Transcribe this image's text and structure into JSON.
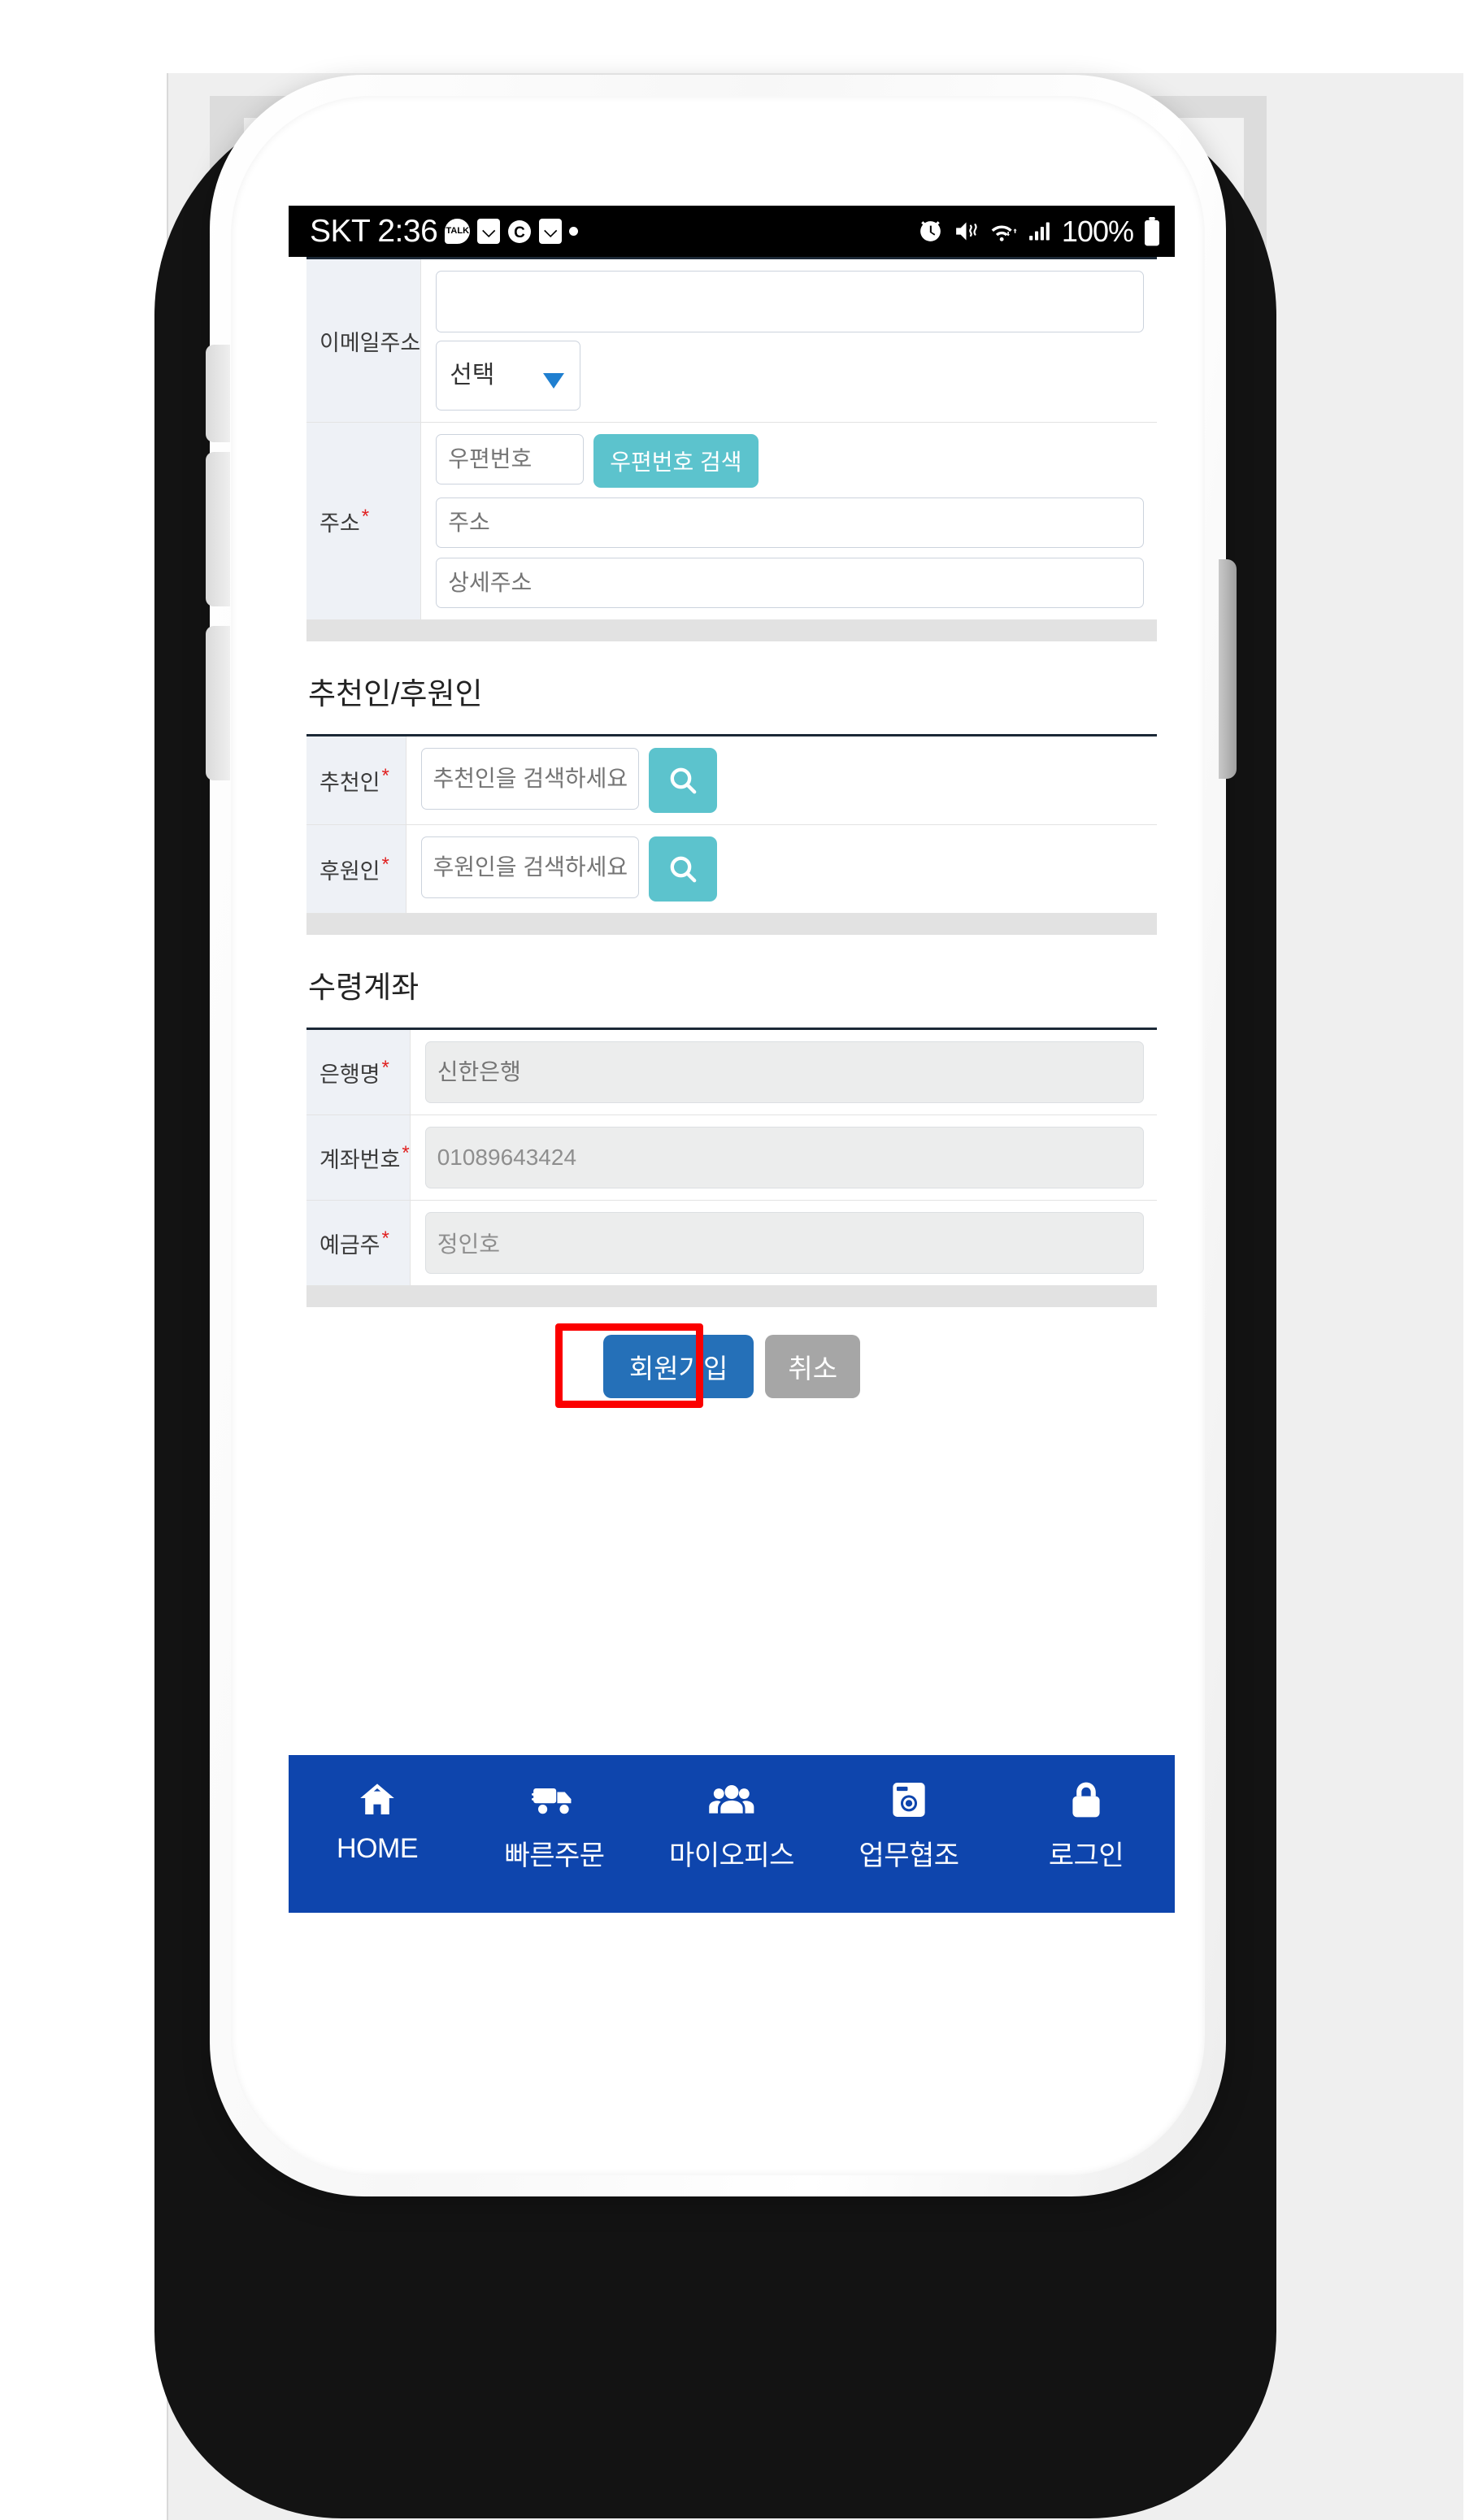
{
  "status_bar": {
    "carrier": "SKT",
    "time": "2:36",
    "talk_icon_label": "TALK",
    "icons": [
      "kakaotalk-icon",
      "smile-icon",
      "c-icon",
      "smile-icon",
      "dot-icon"
    ],
    "right_icons": [
      "alarm-icon",
      "mute-icon",
      "wifi-icon",
      "signal-icon"
    ],
    "battery_percent": "100%"
  },
  "form": {
    "email_row": {
      "label": "이메일주소",
      "input_value": "",
      "input_placeholder": "",
      "select_value": "선택"
    },
    "address_row": {
      "label": "주소",
      "required": "*",
      "zip_placeholder": "우편번호",
      "zip_value": "",
      "zip_button": "우편번호 검색",
      "address_placeholder": "주소",
      "address_value": "",
      "detail_placeholder": "상세주소",
      "detail_value": ""
    }
  },
  "referrer_section": {
    "heading": "추천인/후원인",
    "rows": [
      {
        "label": "추천인",
        "required": "*",
        "placeholder": "추천인을 검색하세요",
        "value": "",
        "button_icon": "search-icon"
      },
      {
        "label": "후원인",
        "required": "*",
        "placeholder": "후원인을 검색하세요",
        "value": "",
        "button_icon": "search-icon"
      }
    ]
  },
  "account_section": {
    "heading": "수령계좌",
    "rows": [
      {
        "label": "은행명",
        "required": "*",
        "value": "신한은행",
        "placeholder": "신한은행",
        "state": "placeholder"
      },
      {
        "label": "계좌번호",
        "required": "*",
        "value": "01089643424",
        "placeholder": "",
        "state": "filled"
      },
      {
        "label": "예금주",
        "required": "*",
        "value": "정인호",
        "placeholder": "",
        "state": "filled"
      }
    ]
  },
  "actions": {
    "submit_label": "회원가입",
    "cancel_label": "취소",
    "highlight_color": "#fb0000",
    "submit_color": "#2570b8",
    "cancel_color": "#a6a6a6"
  },
  "bottom_nav": {
    "background": "#0e45ad",
    "items": [
      {
        "icon": "home-icon",
        "label": "HOME"
      },
      {
        "icon": "truck-icon",
        "label": "빠른주문"
      },
      {
        "icon": "users-icon",
        "label": "마이오피스"
      },
      {
        "icon": "camera-icon",
        "label": "업무협조"
      },
      {
        "icon": "lock-icon",
        "label": "로그인"
      }
    ]
  },
  "theme": {
    "accent_teal": "#5cc3cd",
    "label_bg": "#eef1f6",
    "table_top_border": "#1b2836",
    "footer_bar": "#e2e2e2"
  }
}
